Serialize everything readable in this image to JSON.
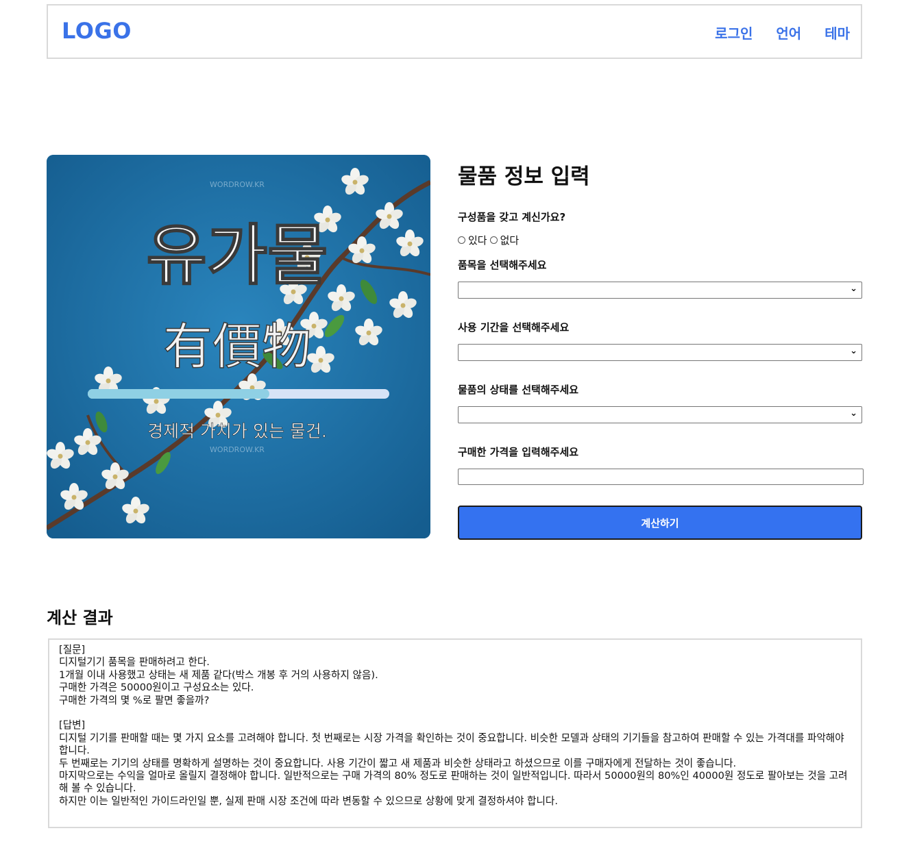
{
  "header": {
    "logo": "LOGO",
    "nav": [
      "로그인",
      "언어",
      "테마"
    ]
  },
  "hero": {
    "title": "유가물",
    "hanja": "有價物",
    "subtitle": "경제적 가치가 있는 물건.",
    "watermark": "WORDROW.KR"
  },
  "form": {
    "title": "물품 정보 입력",
    "component_question": "구성품을 갖고 계신가요?",
    "radio_yes": "있다",
    "radio_no": "없다",
    "item_label": "품목을 선택해주세요",
    "item_value": "",
    "period_label": "사용 기간을 선택해주세요",
    "period_value": "",
    "condition_label": "물품의 상태를 선택해주세요",
    "condition_value": "",
    "price_label": "구매한 가격을 입력해주세요",
    "price_value": "",
    "submit_label": "계산하기"
  },
  "result": {
    "title": "계산 결과",
    "text": "[질문]\n디지털기기 품목을 판매하려고 한다.\n1개월 이내 사용했고 상태는 새 제품 같다(박스 개봉 후 거의 사용하지 않음).\n구매한 가격은 50000원이고 구성요소는 있다.\n구매한 가격의 몇 %로 팔면 좋을까?\n\n[답변]\n디지털 기기를 판매할 때는 몇 가지 요소를 고려해야 합니다. 첫 번째로는 시장 가격을 확인하는 것이 중요합니다. 비슷한 모델과 상태의 기기들을 참고하여 판매할 수 있는 가격대를 파악해야 합니다.\n두 번째로는 기기의 상태를 명확하게 설명하는 것이 중요합니다. 사용 기간이 짧고 새 제품과 비슷한 상태라고 하셨으므로 이를 구매자에게 전달하는 것이 좋습니다.\n마지막으로는 수익을 얼마로 올릴지 결정해야 합니다. 일반적으로는 구매 가격의 80% 정도로 판매하는 것이 일반적입니다. 따라서 50000원의 80%인 40000원 정도로 팔아보는 것을 고려해 볼 수 있습니다.\n하지만 이는 일반적인 가이드라인일 뿐, 실제 판매 시장 조건에 따라 변동할 수 있으므로 상황에 맞게 결정하셔야 합니다."
  },
  "colors": {
    "accent": "#3a72e8",
    "button": "#3472f0",
    "hero_bg": "#1c6ea3"
  }
}
